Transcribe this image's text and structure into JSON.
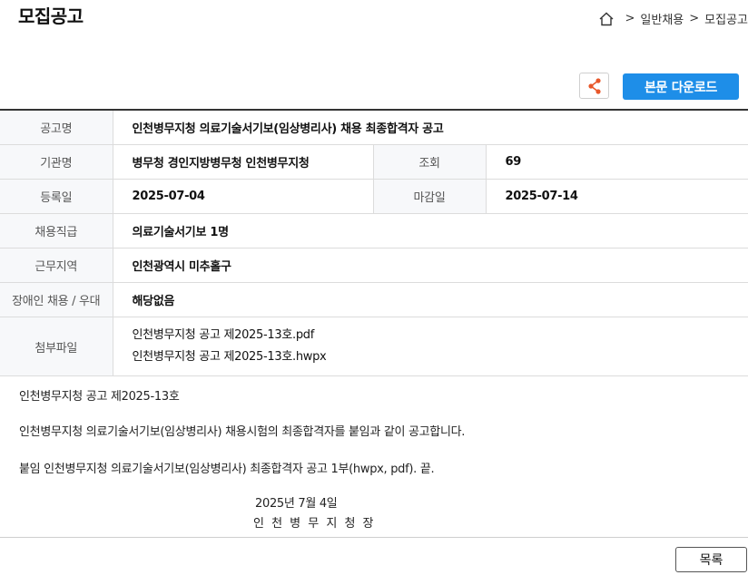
{
  "header": {
    "title": "모집공고",
    "breadcrumb": [
      "일반채용",
      "모집공고"
    ]
  },
  "actions": {
    "download_label": "본문 다운로드",
    "list_label": "목록",
    "accent_color": "#1e8ee8",
    "share_icon_color": "#e8572a"
  },
  "info": {
    "title_label": "공고명",
    "title_value": "인천병무지청 의료기술서기보(임상병리사) 채용 최종합격자 공고",
    "org_label": "기관명",
    "org_value": "병무청 경인지방병무청 인천병무지청",
    "views_label": "조회",
    "views_value": "69",
    "reg_label": "등록일",
    "reg_value": "2025-07-04",
    "deadline_label": "마감일",
    "deadline_value": "2025-07-14",
    "grade_label": "채용직급",
    "grade_value": "의료기술서기보 1명",
    "region_label": "근무지역",
    "region_value": "인천광역시 미추홀구",
    "disabled_label": "장애인 채용 / 우대",
    "disabled_value": "해당없음",
    "attach_label": "첨부파일",
    "attachments": [
      "인천병무지청 공고 제2025-13호.pdf",
      "인천병무지청 공고 제2025-13호.hwpx"
    ]
  },
  "body": {
    "line1": "인천병무지청 공고 제2025-13호",
    "line2": "인천병무지청 의료기술서기보(임상병리사) 채용시험의 최종합격자를 붙임과 같이 공고합니다.",
    "line3": "붙임  인천병무지청 의료기술서기보(임상병리사) 최종합격자 공고 1부(hwpx, pdf).  끝.",
    "date": "2025년 7월 4일",
    "signer": "인 천 병 무 지 청 장"
  }
}
